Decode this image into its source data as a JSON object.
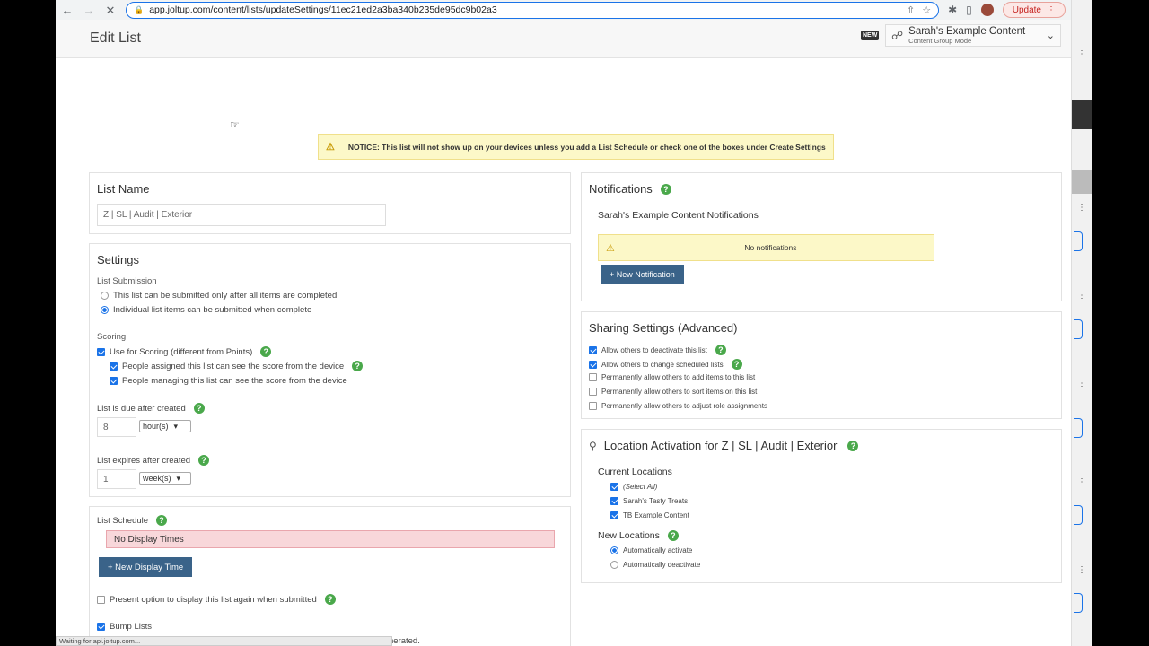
{
  "browser": {
    "url": "app.joltup.com/content/lists/updateSettings/11ec21ed2a3ba340b235de95dc9b02a3",
    "update_label": "Update",
    "status_text": "Waiting for api.joltup.com..."
  },
  "header": {
    "title": "Edit List",
    "new_badge": "NEW",
    "content_group_name": "Sarah's Example Content",
    "content_group_mode": "Content Group Mode"
  },
  "notice": "NOTICE: This list will not show up on your devices unless you add a List Schedule or check one of the boxes under Create Settings",
  "list_name": {
    "title": "List Name",
    "value": "Z | SL | Audit | Exterior"
  },
  "settings": {
    "title": "Settings",
    "submission_label": "List Submission",
    "submission_options": [
      "This list can be submitted only after all items are completed",
      "Individual list items can be submitted when complete"
    ],
    "scoring_label": "Scoring",
    "use_scoring": "Use for Scoring (different from Points)",
    "assigned_see": "People assigned this list can see the score from the device",
    "managing_see": "People managing this list can see the score from the device",
    "due_label": "List is due after created",
    "due_value": "8",
    "due_unit": "hour(s)",
    "expires_label": "List expires after created",
    "expires_value": "1",
    "expires_unit": "week(s)"
  },
  "schedule": {
    "title": "List Schedule",
    "no_display": "No Display Times",
    "new_display_button": "+ New Display Time",
    "present_option": "Present option to display this list again when submitted",
    "bump_lists": "Bump Lists",
    "truncated_text": "nerated."
  },
  "notifications": {
    "title": "Notifications",
    "subtitle": "Sarah's Example Content Notifications",
    "empty": "No notifications",
    "new_button": "+ New Notification"
  },
  "sharing": {
    "title": "Sharing Settings (Advanced)",
    "options": [
      "Allow others to deactivate this list",
      "Allow others to change scheduled lists",
      "Permanently allow others to add items to this list",
      "Permanently allow others to sort items on this list",
      "Permanently allow others to adjust role assignments"
    ]
  },
  "location": {
    "title": "Location Activation for Z | SL | Audit | Exterior",
    "current_label": "Current Locations",
    "current": [
      "(Select All)",
      "Sarah's Tasty Treats",
      "TB Example Content"
    ],
    "new_label": "New Locations",
    "new_options": [
      "Automatically activate",
      "Automatically deactivate"
    ]
  }
}
